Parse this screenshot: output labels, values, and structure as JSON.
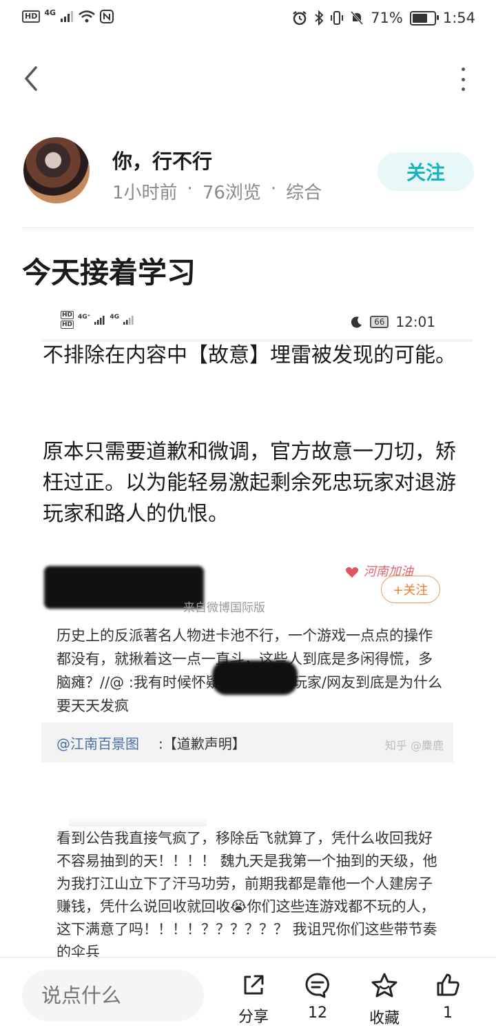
{
  "status_bar": {
    "hd": "HD",
    "network": "4G",
    "battery_percent": "71%",
    "battery_level": 0.71,
    "time": "1:54"
  },
  "author": {
    "name": "你，行不行",
    "time_ago": "1小时前",
    "views": "76浏览",
    "category": "综合",
    "follow_label": "关注",
    "sep": "·"
  },
  "post": {
    "title": "今天接着学习",
    "inner_status": {
      "hd1": "HD",
      "hd2": "HD",
      "net1": "4G⁺",
      "net2": "4G",
      "battery": "66",
      "time": "12:01"
    },
    "paragraph1": "不排除在内容中【故意】埋雷被发现的可能。",
    "paragraph2": "原本只需要道歉和微调，官方故意一刀切，矫枉过正。以为能轻易激起剩余死忠玩家对退游玩家和路人的仇恨。",
    "weibo1": {
      "source": "来自微博国际版",
      "badge": "河南加油",
      "follow": "+关注",
      "text": "历史上的反派著名人物进卡池不行，一个游戏一点点的操作都没有，就揪着这一点一直斗，这些人到底是多闲得慌，多脑瘫？//@ :我有时候怀疑这些精神病玩家/网友到底是为什么要天天发疯",
      "ref_link": "@江南百景图",
      "ref_text": ":【道歉声明】",
      "watermark": "知乎 @麋鹿"
    },
    "weibo2": {
      "text": "看到公告我直接气疯了，移除岳飞就算了，凭什么收回我好不容易抽到的天！！！！ 魏九天是我第一个抽到的天级，他为我打江山立下了汗马功劳，前期我都是靠他一个人建房子赚钱，凭什么说回收就回收😭你们这些连游戏都不玩的人，这下满意了吗！！！！？？？？？？ 我诅咒你们这些带节奏的伞兵"
    }
  },
  "bottom_bar": {
    "input_placeholder": "说点什么",
    "share_label": "分享",
    "comment_count": "12",
    "favorite_label": "收藏",
    "like_count": "1"
  }
}
